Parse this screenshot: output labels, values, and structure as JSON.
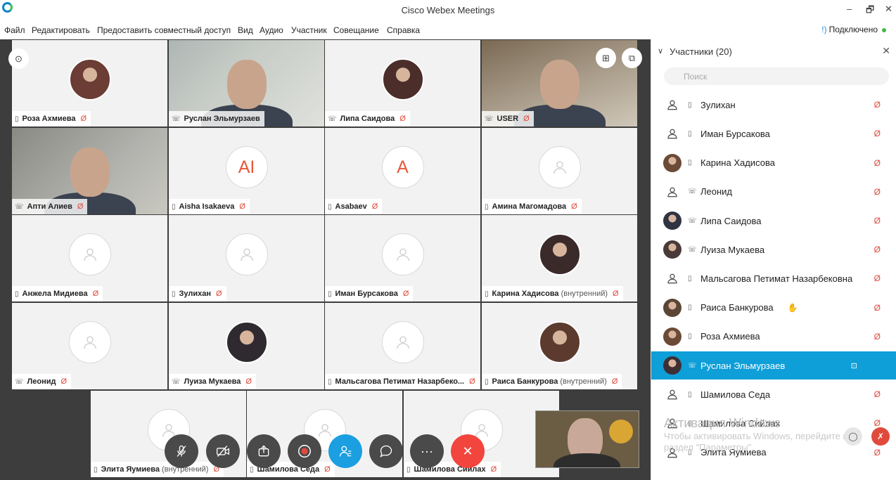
{
  "window": {
    "title": "Cisco Webex Meetings",
    "minimize": "–",
    "maximize": "🗗",
    "close": "✕"
  },
  "menu": [
    "Файл",
    "Редактировать",
    "Предоставить совместный доступ",
    "Вид",
    "Аудио",
    "Участник",
    "Совещание",
    "Справка"
  ],
  "status": {
    "connection": "Подключено",
    "icon": "signal-icon",
    "color": "#3dbb45"
  },
  "icons": {
    "mic_muted": "🎙̸",
    "mic_glyph": "🎤",
    "phone_glyph": "☏",
    "device_glyph": "▯",
    "hand_glyph": "✋",
    "camera_glyph": "⊡",
    "person_glyph": "⚇"
  },
  "tiles": [
    {
      "name": "Роза Ахмиева",
      "device": "▯",
      "kind": "photo",
      "muted": true
    },
    {
      "name": "Руслан Эльмурзаев",
      "device": "☏",
      "kind": "video",
      "muted": false
    },
    {
      "name": "Липа Саидова",
      "device": "☏",
      "kind": "photo",
      "muted": true
    },
    {
      "name": "USER",
      "device": "☏",
      "kind": "video",
      "muted": true
    },
    {
      "name": "Апти Алиев",
      "device": "☏",
      "kind": "video",
      "muted": true
    },
    {
      "name": "Aisha Isakaeva",
      "device": "▯",
      "kind": "initials",
      "initials": "AI",
      "muted": true
    },
    {
      "name": "Asabaev",
      "device": "▯",
      "kind": "initials",
      "initials": "A",
      "muted": true
    },
    {
      "name": "Амина Магомадова",
      "device": "▯",
      "kind": "generic",
      "muted": true
    },
    {
      "name": "Анжела Мидиева",
      "device": "▯",
      "kind": "generic",
      "muted": true
    },
    {
      "name": "Зулихан",
      "device": "▯",
      "kind": "generic",
      "muted": true
    },
    {
      "name": "Иман Бурсакова",
      "device": "▯",
      "kind": "generic",
      "muted": true
    },
    {
      "name": "Карина Хадисова",
      "sub": "(внутренний)",
      "device": "▯",
      "kind": "photo",
      "muted": true
    },
    {
      "name": "Леонид",
      "device": "☏",
      "kind": "generic",
      "muted": true
    },
    {
      "name": "Луиза Мукаева",
      "device": "☏",
      "kind": "photo",
      "muted": true
    },
    {
      "name": "Мальсагова Петимат Назарбеко...",
      "device": "▯",
      "kind": "generic",
      "muted": true
    },
    {
      "name": "Раиса Банкурова",
      "sub": "(внутренний)",
      "device": "▯",
      "kind": "photo",
      "muted": true
    },
    {
      "name": "Элита Яумиева",
      "sub": "(внутренний)",
      "device": "▯",
      "kind": "generic",
      "muted": true
    },
    {
      "name": "Шамилова Седа",
      "device": "▯",
      "kind": "generic",
      "muted": true
    },
    {
      "name": "Шамилова Сийлах",
      "device": "▯",
      "kind": "generic",
      "muted": true
    }
  ],
  "controls": {
    "mute": "mic-muted-icon",
    "video": "video-off-icon",
    "share": "share-icon",
    "record": "record-icon",
    "participants": "participants-icon",
    "chat": "chat-icon",
    "more": "more-icon",
    "end": "end-call-icon",
    "more_glyph": "···",
    "end_glyph": "✕"
  },
  "panel": {
    "title": "Участники (20)",
    "close": "✕",
    "chevron": "∨",
    "search_placeholder": "Поиск",
    "search_glyph": "🔍",
    "participants": [
      {
        "name": "Апти Алиев",
        "device": "☏",
        "avatar": "generic",
        "cam": true,
        "muted": true,
        "partial": true
      },
      {
        "name": "Зулихан",
        "device": "▯",
        "avatar": "generic",
        "muted": true
      },
      {
        "name": "Иман Бурсакова",
        "device": "▯",
        "avatar": "generic",
        "muted": true
      },
      {
        "name": "Карина Хадисова",
        "device": "▯",
        "avatar": "photo",
        "muted": true
      },
      {
        "name": "Леонид",
        "device": "☏",
        "avatar": "generic",
        "muted": true
      },
      {
        "name": "Липа Саидова",
        "device": "☏",
        "avatar": "photo",
        "muted": true
      },
      {
        "name": "Луиза Мукаева",
        "device": "☏",
        "avatar": "photo",
        "muted": true
      },
      {
        "name": "Мальсагова Петимат Назарбековна",
        "device": "▯",
        "avatar": "generic",
        "muted": true
      },
      {
        "name": "Раиса Банкурова",
        "device": "▯",
        "avatar": "photo",
        "muted": true,
        "hand": true
      },
      {
        "name": "Роза Ахмиева",
        "device": "▯",
        "avatar": "photo",
        "muted": true
      },
      {
        "name": "Руслан Эльмурзаев",
        "device": "☏",
        "avatar": "photo",
        "muted": false,
        "selected": true,
        "cam": true
      },
      {
        "name": "Шамилова Седа",
        "device": "▯",
        "avatar": "generic",
        "muted": true
      },
      {
        "name": "Шамилова Сийлах",
        "device": "▯",
        "avatar": "generic",
        "muted": true
      },
      {
        "name": "Элита Яумиева",
        "device": "▯",
        "avatar": "generic",
        "muted": true
      }
    ]
  },
  "watermark": {
    "title": "Активация Windows",
    "line1": "Чтобы активировать Windows, перейдите в",
    "line2": "раздел \"Параметры\"."
  }
}
